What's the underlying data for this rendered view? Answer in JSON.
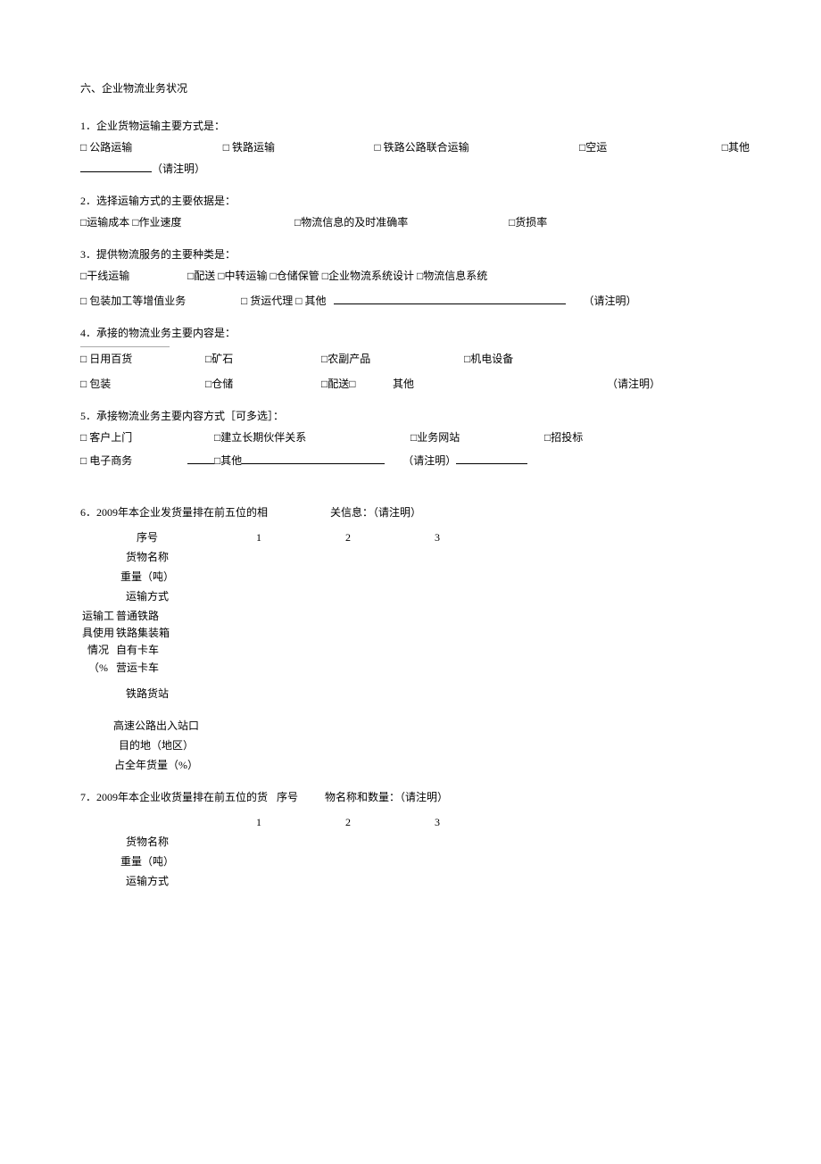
{
  "section_title": "六、企业物流业务状况",
  "q1": {
    "title": "1．企业货物运输主要方式是：",
    "opts": [
      "□  公路运输",
      "□ 铁路运输",
      "□ 铁路公路联合运输",
      "□空运",
      "□其他"
    ],
    "note": "（请注明）"
  },
  "q2": {
    "title": "2．选择运输方式的主要依据是：",
    "opts": [
      "□运输成本 □作业速度",
      "□物流信息的及时准确率",
      "□货损率"
    ]
  },
  "q3": {
    "title": "3．提供物流服务的主要种类是：",
    "line1": [
      "□干线运输",
      "□配送  □中转运输  □仓储保管  □企业物流系统设计  □物流信息系统"
    ],
    "line2": [
      "□  包装加工等增值业务",
      "□ 货运代理 □ 其他",
      "（请注明）"
    ]
  },
  "q4": {
    "title": "4．承接的物流业务主要内容是：",
    "line1": [
      "□ 日用百货",
      "□矿石",
      "□农副产品",
      "□机电设备"
    ],
    "line2": [
      "□ 包装",
      "□仓储",
      "□配送□",
      "其他",
      "（请注明）"
    ]
  },
  "q5": {
    "title": "5．承接物流业务主要内容方式［可多选］：",
    "line1": [
      "□ 客户上门",
      "□建立长期伙伴关系",
      "□业务网站",
      "□招投标"
    ],
    "line2": [
      "□ 电子商务",
      "□其他",
      "（请注明）"
    ]
  },
  "q6": {
    "intro_left": "6．2009年本企业发货量排在前五位的相",
    "intro_right": "关信息：（请注明）",
    "header_label": "序号",
    "cols": [
      "1",
      "2",
      "3"
    ],
    "rows_a": [
      "货物名称",
      "重量（吨）",
      "运输方式"
    ],
    "tool_group_label": "运输工具使用情况（%",
    "tool_rows": [
      "普通铁路",
      "铁路集装箱",
      "自有卡车",
      "营运卡车"
    ],
    "rows_b": [
      "铁路货站",
      "高速公路出入站口",
      "目的地（地区）",
      "占全年货量（%）"
    ]
  },
  "q7": {
    "intro_left": "7．2009年本企业收货量排在前五位的货",
    "intro_right": "物名称和数量：（请注明）",
    "header_label": "序号",
    "cols": [
      "1",
      "2",
      "3"
    ],
    "rows": [
      "货物名称",
      "重量（吨）",
      "运输方式"
    ]
  }
}
